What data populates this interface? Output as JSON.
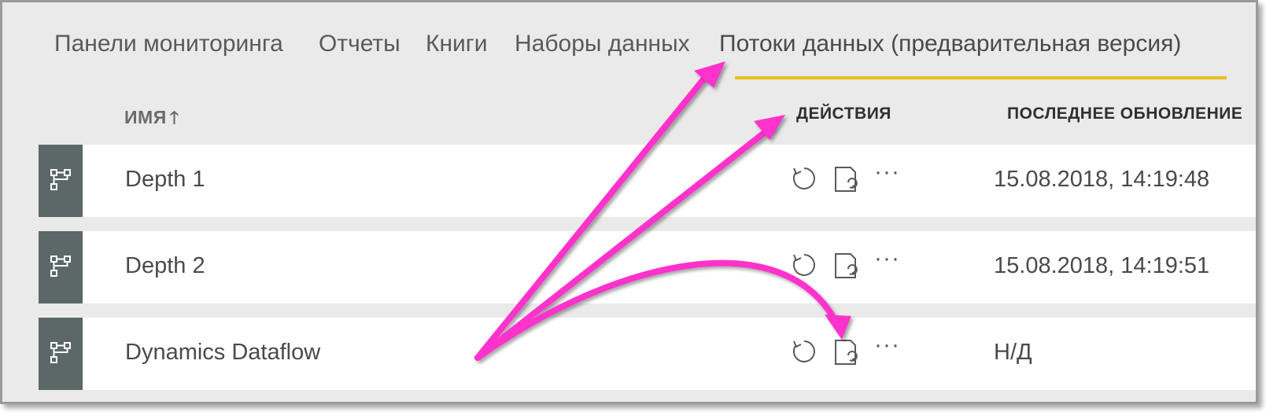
{
  "tabs": [
    {
      "label": "Панели мониторинга",
      "active": false
    },
    {
      "label": "Отчеты",
      "active": false
    },
    {
      "label": "Книги",
      "active": false
    },
    {
      "label": "Наборы данных",
      "active": false
    },
    {
      "label": "Потоки данных (предварительная версия)",
      "active": true
    }
  ],
  "columns": {
    "name": "ИМЯ",
    "name_sort_icon": "arrow-up-icon",
    "actions": "ДЕЙСТВИЯ",
    "last_updated": "ПОСЛЕДНЕЕ ОБНОВЛЕНИЕ"
  },
  "rows": [
    {
      "name": "Depth 1",
      "last_updated": "15.08.2018, 14:19:48"
    },
    {
      "name": "Depth 2",
      "last_updated": "15.08.2018, 14:19:51"
    },
    {
      "name": "Dynamics Dataflow",
      "last_updated": "Н/Д"
    }
  ],
  "row_actions": {
    "refresh_icon": "refresh-icon",
    "schedule_icon": "schedule-refresh-icon",
    "more_label": "···"
  },
  "icons": {
    "row_icon": "dataflow-icon"
  },
  "colors": {
    "background": "#eaeaea",
    "active_tab_underline": "#e8bf1e",
    "row_icon_bg": "#5c6767",
    "annotation_arrow": "#ff33cc"
  }
}
